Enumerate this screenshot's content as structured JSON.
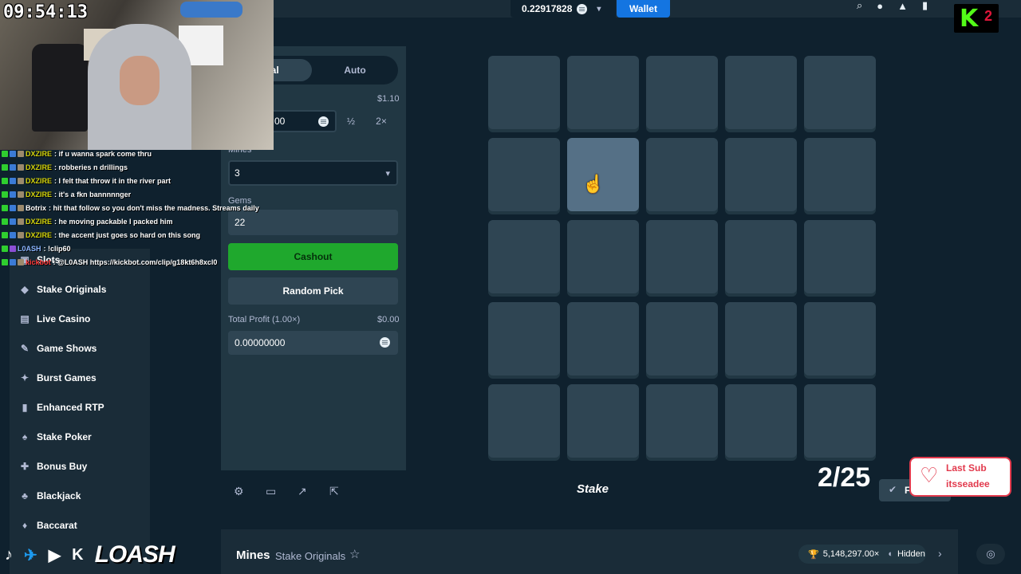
{
  "header": {
    "balance": "0.22917828",
    "wallet_label": "Wallet",
    "icons": [
      "search-icon",
      "user-icon",
      "bell-icon",
      "chat-icon"
    ]
  },
  "sidebar": {
    "items": [
      {
        "label": "Slots",
        "icon": "slots-icon"
      },
      {
        "label": "Stake Originals",
        "icon": "originals-icon"
      },
      {
        "label": "Live Casino",
        "icon": "live-casino-icon"
      },
      {
        "label": "Game Shows",
        "icon": "game-shows-icon"
      },
      {
        "label": "Burst Games",
        "icon": "burst-icon"
      },
      {
        "label": "Enhanced RTP",
        "icon": "rtp-icon"
      },
      {
        "label": "Stake Poker",
        "icon": "poker-icon"
      },
      {
        "label": "Bonus Buy",
        "icon": "bonus-icon"
      },
      {
        "label": "Blackjack",
        "icon": "blackjack-icon"
      },
      {
        "label": "Baccarat",
        "icon": "baccarat-icon"
      }
    ]
  },
  "controls": {
    "tab_manual": "ual",
    "tab_auto": "Auto",
    "bet_label": "t",
    "bet_usd": "$1.10",
    "bet_value": "00",
    "half": "½",
    "double": "2×",
    "mines_label": "Mines",
    "mines_value": "3",
    "gems_label": "Gems",
    "gems_value": "22",
    "cashout": "Cashout",
    "random_pick": "Random Pick",
    "profit_label": "Total Profit (1.00×)",
    "profit_usd": "$0.00",
    "profit_value": "0.00000000"
  },
  "board": {
    "rows": 5,
    "cols": 5,
    "hovered_tile": [
      1,
      1
    ]
  },
  "footer": {
    "logo": "Stake",
    "fairness": "F"
  },
  "game_info": {
    "name": "Mines",
    "category": "Stake Originals",
    "stat": "5,148,297.00×",
    "hidden_label": "Hidden"
  },
  "overlay": {
    "clock": "09:54:13",
    "chat": [
      {
        "user": "DXZIRE",
        "msg": ": if u wanna spark come thru"
      },
      {
        "user": "DXZIRE",
        "msg": ": robberies n drillings"
      },
      {
        "user": "DXZIRE",
        "msg": ": I felt that throw it in the river part"
      },
      {
        "user": "DXZIRE",
        "msg": ": it's a fkn bannnnnger"
      },
      {
        "user": "Botrix",
        "msg": ": hit that follow so you don't miss the madness. Streams daily"
      },
      {
        "user": "DXZIRE",
        "msg": ": he moving packable I packed him"
      },
      {
        "user": "DXZIRE",
        "msg": ": the accent just goes so hard on this song"
      },
      {
        "user": "L0ASH",
        "msg": ": !clip60"
      },
      {
        "user": "kickbot",
        "msg": ": @L0ASH https://kickbot.com/clip/g18kt6h8xcl0"
      }
    ],
    "kick_count": "2",
    "counter": "2/25",
    "last_sub_title": "Last Sub",
    "last_sub_user": "itsseadee",
    "brand": "LOASH"
  }
}
